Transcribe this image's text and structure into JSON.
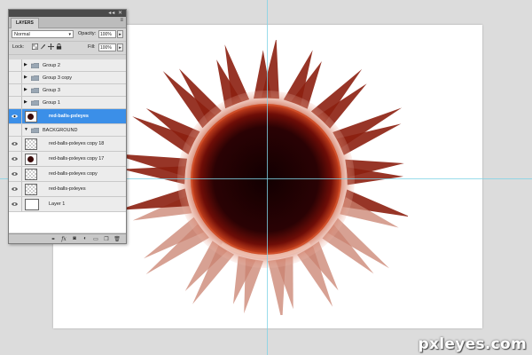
{
  "layers_panel": {
    "tab_label": "LAYERS",
    "blend_mode": "Normal",
    "opacity_label": "Opacity:",
    "opacity_value": "100%",
    "lock_label": "Lock:",
    "fill_label": "Fill:",
    "fill_value": "100%",
    "layers": [
      {
        "name": "Group 2",
        "kind": "group",
        "visible": false,
        "selected": false
      },
      {
        "name": "Group 3 copy",
        "kind": "group",
        "visible": false,
        "selected": false
      },
      {
        "name": "Group 3",
        "kind": "group",
        "visible": false,
        "selected": false
      },
      {
        "name": "Group 1",
        "kind": "group",
        "visible": false,
        "selected": false
      },
      {
        "name": "red-balls-pxleyes",
        "kind": "pixel",
        "visible": true,
        "selected": true
      },
      {
        "name": "BACKGROUND",
        "kind": "group-open",
        "visible": false,
        "selected": false
      },
      {
        "name": "red-balls-pxleyes copy 18",
        "kind": "pixel",
        "visible": true,
        "selected": false
      },
      {
        "name": "red-balls-pxleyes copy 17",
        "kind": "pixel",
        "visible": true,
        "selected": false
      },
      {
        "name": "red-balls-pxleyes copy",
        "kind": "pixel",
        "visible": true,
        "selected": false
      },
      {
        "name": "red-balls-pxleyes",
        "kind": "pixel",
        "visible": true,
        "selected": false
      },
      {
        "name": "Layer 1",
        "kind": "pixel-white",
        "visible": true,
        "selected": false
      }
    ]
  },
  "watermark": "pxleyes.com",
  "colors": {
    "selection": "#3b8fe8",
    "guide": "#7fd3e6",
    "art_dark": "#2a0204",
    "art_red": "#b8331c"
  }
}
